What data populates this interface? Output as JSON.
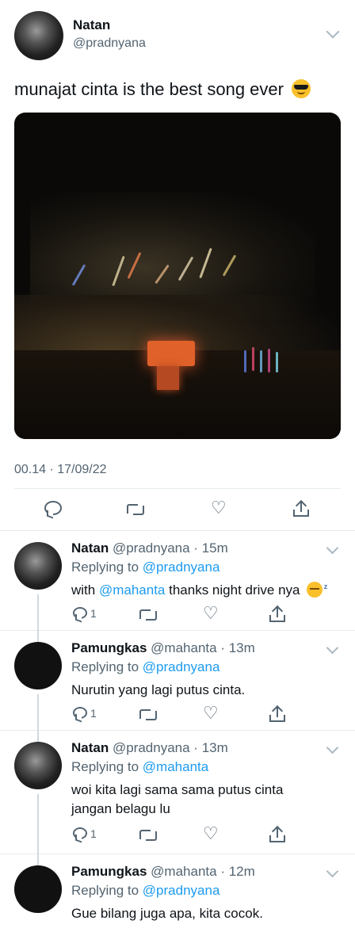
{
  "main_tweet": {
    "name": "Natan",
    "handle": "@pradnyana",
    "text": "munajat cinta is the best song ever",
    "emoji": "smiling-face-with-sunglasses",
    "timestamp": "00.14 · 17/09/22"
  },
  "replies": [
    {
      "name": "Natan",
      "handle": "@pradnyana",
      "time": "15m",
      "replying_label": "Replying to",
      "replying_to": "@pradnyana",
      "body_prefix": "with",
      "body_mention": "@mahanta",
      "body_suffix": "thanks night drive nya",
      "emoji": "sleeping-face",
      "reply_count": "1"
    },
    {
      "name": "Pamungkas",
      "handle": "@mahanta",
      "time": "13m",
      "replying_label": "Replying to",
      "replying_to": "@pradnyana",
      "body": "Nurutin yang lagi putus cinta.",
      "reply_count": "1"
    },
    {
      "name": "Natan",
      "handle": "@pradnyana",
      "time": "13m",
      "replying_label": "Replying to",
      "replying_to": "@mahanta",
      "body_line1": "woi kita lagi sama sama putus cinta",
      "body_line2": "jangan belagu lu",
      "reply_count": "1"
    },
    {
      "name": "Pamungkas",
      "handle": "@mahanta",
      "time": "12m",
      "replying_label": "Replying to",
      "replying_to": "@pradnyana",
      "body": "Gue bilang juga apa, kita cocok."
    }
  ],
  "colors": {
    "link": "#1d9bf0",
    "muted": "#536471",
    "text": "#0f1419",
    "divider": "#e6ecf0"
  }
}
